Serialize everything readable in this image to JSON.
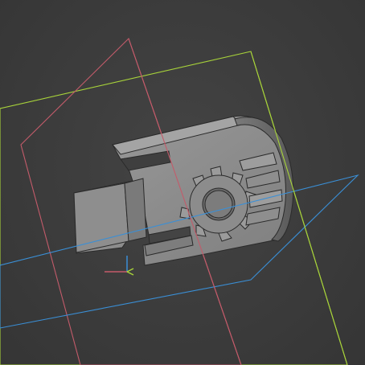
{
  "viewport": {
    "background": "#3d3d3d",
    "view": "3d-model-viewport"
  },
  "datum_planes": [
    {
      "name": "xy-plane",
      "color": "#3a8fd6"
    },
    {
      "name": "xz-plane",
      "color": "#c35b6a"
    },
    {
      "name": "yz-plane",
      "color": "#a8d33a"
    }
  ],
  "model": {
    "name": "gear-hub-part",
    "body_color": "#8a8a8a",
    "edge_color": "#2a2a2a"
  },
  "origin_triad": {
    "x_color": "#c35b6a",
    "y_color": "#a8d33a",
    "z_color": "#3a8fd6"
  }
}
